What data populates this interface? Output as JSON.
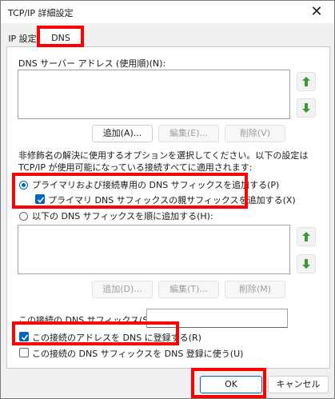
{
  "window": {
    "title": "TCP/IP 詳細設定",
    "close_glyph": "✕"
  },
  "tabs": [
    {
      "label": "IP 設定"
    },
    {
      "label": "DNS"
    }
  ],
  "dns": {
    "servers_label": "DNS サーバー アドレス (使用順)(N):",
    "add_button": "追加(A)...",
    "edit_button": "編集(E)...",
    "remove_button": "削除(V)",
    "resolution_info": "非修飾名の解決に使用するオプションを選択してください。以下の設定は TCP/IP が使用可能になっている接続すべてに適用されます:",
    "radio_primary_label": "プライマリおよび接続専用の DNS サフィックスを追加する(P)",
    "check_parent_label": "プライマリ DNS サフィックスの親サフィックスを追加する(X)",
    "radio_order_label": "以下の DNS サフィックスを順に追加する(H):",
    "add_button2": "追加(D)...",
    "edit_button2": "編集(T)...",
    "remove_button2": "削除(M)",
    "suffix_label": "この接続の DNS サフィックス(S):",
    "suffix_value": "",
    "register_label": "この接続のアドレスを DNS に登録する(R)",
    "use_suffix_label": "この接続の DNS サフィックスを DNS 登録に使う(U)"
  },
  "footer": {
    "ok": "OK",
    "cancel": "キャンセル"
  },
  "colors": {
    "accent": "#0067c0",
    "highlight": "#ff0000",
    "arrow_green": "#3a9a3a"
  }
}
